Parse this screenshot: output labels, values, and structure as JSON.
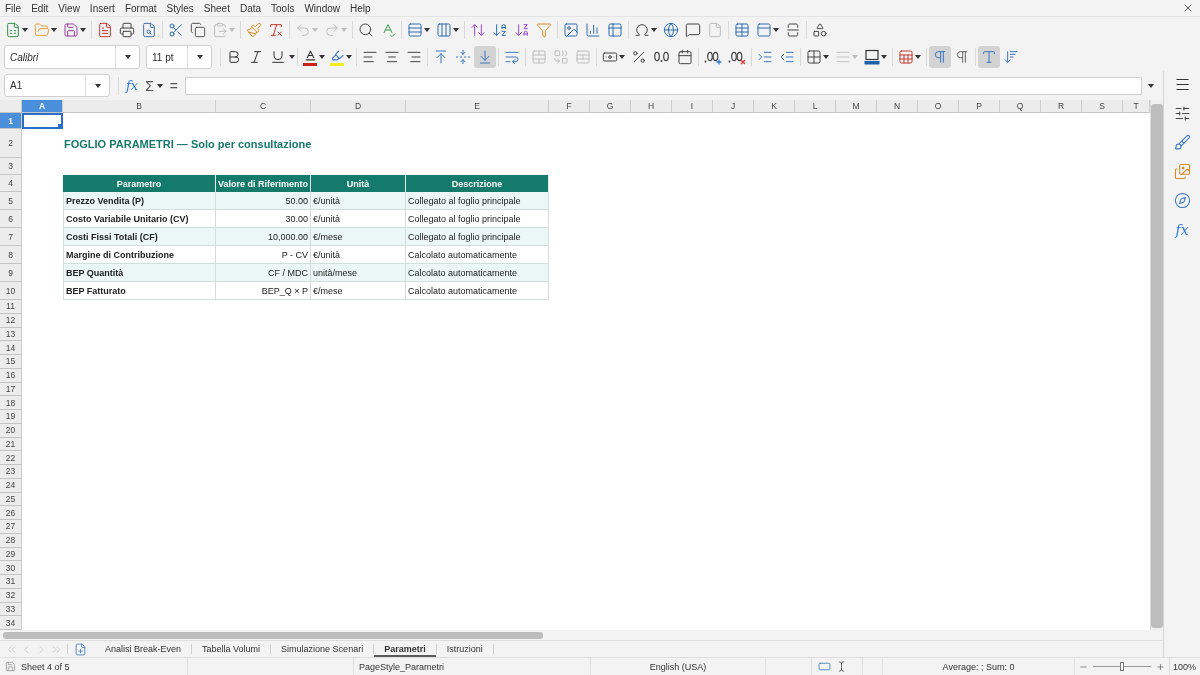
{
  "menu_bar": {
    "items": [
      "File",
      "Edit",
      "View",
      "Insert",
      "Format",
      "Styles",
      "Sheet",
      "Data",
      "Tools",
      "Window",
      "Help"
    ]
  },
  "standard_toolbar": {
    "buttons": [
      {
        "disabled": false
      },
      {
        "disabled": false
      },
      {
        "disabled": false
      },
      {
        "disabled": false
      },
      {
        "disabled": false
      },
      {
        "disabled": false
      },
      {
        "disabled": false
      },
      {
        "disabled": false
      },
      {
        "disabled": true
      },
      {
        "disabled": false
      },
      {
        "disabled": false
      },
      {
        "disabled": true
      },
      {
        "disabled": true
      },
      {
        "disabled": false
      },
      {
        "disabled": false
      },
      {
        "disabled": false
      },
      {
        "disabled": false
      },
      {
        "disabled": false
      },
      {
        "disabled": false
      },
      {
        "disabled": false
      },
      {
        "disabled": false
      },
      {
        "disabled": false
      },
      {
        "disabled": false
      },
      {
        "disabled": false
      },
      {
        "disabled": false
      },
      {
        "disabled": false
      },
      {
        "disabled": false
      },
      {
        "disabled": true
      },
      {
        "disabled": false
      },
      {
        "disabled": false
      },
      {
        "disabled": false
      },
      {
        "disabled": false
      }
    ]
  },
  "formatting_toolbar": {
    "font_name": "Calibri",
    "font_size": "11 pt",
    "text_style": [
      {
        "selected": false
      },
      {
        "selected": false
      },
      {
        "selected": false
      }
    ],
    "horizontal_align": [
      {
        "selected": false
      },
      {
        "selected": false
      },
      {
        "selected": false
      }
    ],
    "vertical_align": [
      {
        "selected": false
      },
      {
        "selected": false
      },
      {
        "selected": true
      }
    ],
    "merge": [
      {
        "disabled": true
      },
      {
        "disabled": true
      },
      {
        "disabled": true
      }
    ],
    "border_style": {
      "disabled": true
    },
    "paragraph_direction": [
      {
        "selected": true
      },
      {
        "selected": false
      }
    ],
    "text_direction": [
      {
        "selected": true
      },
      {
        "selected": false
      }
    ]
  },
  "formula_bar": {
    "name_box": "A1",
    "function_wizard": "fx",
    "sum": "Σ",
    "equals": "="
  },
  "sidebar": {
    "functions": "fx"
  },
  "column_headers": [
    {
      "label": "A",
      "selected": true
    },
    {
      "label": "B",
      "selected": false
    },
    {
      "label": "C",
      "selected": false
    },
    {
      "label": "D",
      "selected": false
    },
    {
      "label": "E",
      "selected": false
    },
    {
      "label": "F",
      "selected": false
    },
    {
      "label": "G",
      "selected": false
    },
    {
      "label": "H",
      "selected": false
    },
    {
      "label": "I",
      "selected": false
    },
    {
      "label": "J",
      "selected": false
    },
    {
      "label": "K",
      "selected": false
    },
    {
      "label": "L",
      "selected": false
    },
    {
      "label": "M",
      "selected": false
    },
    {
      "label": "N",
      "selected": false
    },
    {
      "label": "O",
      "selected": false
    },
    {
      "label": "P",
      "selected": false
    },
    {
      "label": "Q",
      "selected": false
    },
    {
      "label": "R",
      "selected": false
    },
    {
      "label": "S",
      "selected": false
    },
    {
      "label": "T",
      "selected": false
    }
  ],
  "row_headers": [
    {
      "label": "1",
      "selected": true
    },
    {
      "label": "2",
      "selected": false
    },
    {
      "label": "3",
      "selected": false
    },
    {
      "label": "4",
      "selected": false
    },
    {
      "label": "5",
      "selected": false
    },
    {
      "label": "6",
      "selected": false
    },
    {
      "label": "7",
      "selected": false
    },
    {
      "label": "8",
      "selected": false
    },
    {
      "label": "9",
      "selected": false
    },
    {
      "label": "10",
      "selected": false
    },
    {
      "label": "11",
      "selected": false
    },
    {
      "label": "12",
      "selected": false
    },
    {
      "label": "13",
      "selected": false
    },
    {
      "label": "14",
      "selected": false
    },
    {
      "label": "15",
      "selected": false
    },
    {
      "label": "16",
      "selected": false
    },
    {
      "label": "17",
      "selected": false
    },
    {
      "label": "18",
      "selected": false
    },
    {
      "label": "19",
      "selected": false
    },
    {
      "label": "20",
      "selected": false
    },
    {
      "label": "21",
      "selected": false
    },
    {
      "label": "22",
      "selected": false
    },
    {
      "label": "23",
      "selected": false
    },
    {
      "label": "24",
      "selected": false
    },
    {
      "label": "25",
      "selected": false
    },
    {
      "label": "26",
      "selected": false
    },
    {
      "label": "27",
      "selected": false
    },
    {
      "label": "28",
      "selected": false
    },
    {
      "label": "29",
      "selected": false
    },
    {
      "label": "30",
      "selected": false
    },
    {
      "label": "31",
      "selected": false
    },
    {
      "label": "32",
      "selected": false
    },
    {
      "label": "33",
      "selected": false
    },
    {
      "label": "34",
      "selected": false
    }
  ],
  "sheet": {
    "title": "FOGLIO PARAMETRI — Solo per consultazione",
    "table": {
      "columns": [
        "Parametro",
        "Valore di Riferimento",
        "Unità",
        "Descrizione"
      ],
      "rows": [
        {
          "shaded": true,
          "cells": [
            "Prezzo Vendita (P)",
            "50.00",
            "€/unità",
            "Collegato al foglio principale"
          ]
        },
        {
          "shaded": false,
          "cells": [
            "Costo Variabile Unitario (CV)",
            "30.00",
            "€/unità",
            "Collegato al foglio principale"
          ]
        },
        {
          "shaded": true,
          "cells": [
            "Costi Fissi Totali (CF)",
            "10,000.00",
            "€/mese",
            "Collegato al foglio principale"
          ]
        },
        {
          "shaded": false,
          "cells": [
            "Margine di Contribuzione",
            "P - CV",
            "€/unità",
            "Calcolato automaticamente"
          ]
        },
        {
          "shaded": true,
          "cells": [
            "BEP Quantità",
            "CF / MDC",
            "unità/mese",
            "Calcolato automaticamente"
          ]
        },
        {
          "shaded": false,
          "cells": [
            "BEP Fatturato",
            "BEP_Q × P",
            "€/mese",
            "Calcolato automaticamente"
          ]
        }
      ]
    }
  },
  "sheet_nav": [
    {
      "disabled": true
    },
    {
      "disabled": true
    },
    {
      "disabled": true
    },
    {
      "disabled": true
    }
  ],
  "sheet_tabs": [
    {
      "label": "Analisi Break-Even",
      "selected": false
    },
    {
      "label": "Tabella Volumi",
      "selected": false
    },
    {
      "label": "Simulazione Scenari",
      "selected": false
    },
    {
      "label": "Parametri",
      "selected": true
    },
    {
      "label": "Istruzioni",
      "selected": false
    }
  ],
  "status_bar": {
    "sheet_position": "Sheet 4 of 5",
    "page_style": "PageStyle_Parametri",
    "language": "English (USA)",
    "selection_summary": "Average: ; Sum: 0",
    "zoom": {
      "level": 0.5,
      "reading": "100%"
    }
  }
}
